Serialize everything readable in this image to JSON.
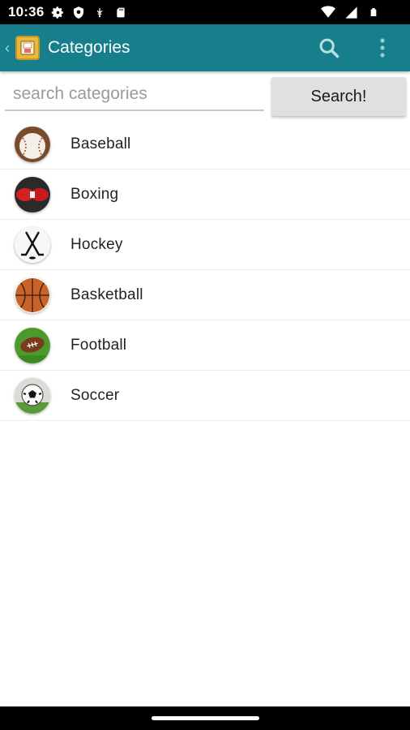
{
  "status_bar": {
    "time": "10:36",
    "icons_left": [
      "gear-icon",
      "shield-icon",
      "usb-icon",
      "sd-card-icon"
    ],
    "icons_right": [
      "wifi-icon",
      "signal-icon",
      "battery-icon"
    ]
  },
  "app_bar": {
    "title": "Categories",
    "back_icon": "chevron-left-icon",
    "logo_icon": "app-logo-icon",
    "actions": [
      "search-icon",
      "overflow-menu-icon"
    ]
  },
  "search": {
    "placeholder": "search categories",
    "value": "",
    "button_label": "Search!"
  },
  "categories": [
    {
      "label": "Baseball",
      "icon": "baseball-icon"
    },
    {
      "label": "Boxing",
      "icon": "boxing-glove-icon"
    },
    {
      "label": "Hockey",
      "icon": "hockey-sticks-icon"
    },
    {
      "label": "Basketball",
      "icon": "basketball-icon"
    },
    {
      "label": "Football",
      "icon": "football-icon"
    },
    {
      "label": "Soccer",
      "icon": "soccer-ball-icon"
    }
  ],
  "colors": {
    "app_bar": "#177f8c",
    "status_bar": "#000000",
    "search_button": "#e0e0e0"
  }
}
